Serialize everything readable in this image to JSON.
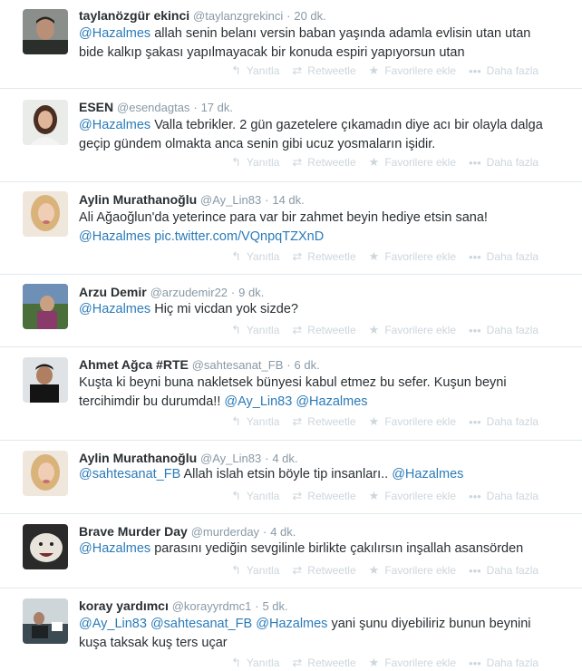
{
  "action_labels": {
    "reply": "Yanıtla",
    "retweet": "Retweetle",
    "favorite": "Favorilere ekle",
    "more": "Daha fazla"
  },
  "tweets": [
    {
      "fullname": "taylanözgür ekinci",
      "handle": "@taylanzgrekinci",
      "dot": "·",
      "time": "20 dk.",
      "mentions_before": "@Hazalmes",
      "text_line1": " allah senin belanı versin baban yaşında adamla evlisin utan utan",
      "text_line2": "bide kalkıp şakası yapılmayacak bir konuda espiri yapıyorsun utan"
    },
    {
      "fullname": "ESEN",
      "handle": "@esendagtas",
      "dot": "·",
      "time": "17 dk.",
      "mentions_before": "@Hazalmes",
      "text_line1": " Valla tebrikler. 2 gün gazetelere çıkamadın diye acı bir olayla dalga",
      "text_line2": "geçip gündem olmakta anca senin gibi ucuz yosmaların işidir."
    },
    {
      "fullname": "Aylin Murathanoğlu",
      "handle": "@Ay_Lin83",
      "dot": "·",
      "time": "14 dk.",
      "text_line1": "Ali Ağaoğlun'da yeterince para var bir zahmet beyin hediye etsin sana!",
      "line2_mention": "@Hazalmes",
      "line2_link": " pic.twitter.com/VQnpqTZXnD"
    },
    {
      "fullname": "Arzu Demir",
      "handle": "@arzudemir22",
      "dot": "·",
      "time": "9 dk.",
      "mentions_before": "@Hazalmes",
      "text_line1": " Hiç mi vicdan yok sizde?"
    },
    {
      "fullname": "Ahmet Ağca #RTE",
      "handle": "@sahtesanat_FB",
      "dot": "·",
      "time": "6 dk.",
      "text_line1": "Kuşta ki beyni buna nakletsek bünyesi kabul etmez bu sefer. Kuşun beyni",
      "text_line2": "tercihimdir bu durumda!! ",
      "mention_a": "@Ay_Lin83",
      "mention_b": " @Hazalmes"
    },
    {
      "fullname": "Aylin Murathanoğlu",
      "handle": "@Ay_Lin83",
      "dot": "·",
      "time": "4 dk.",
      "mentions_before": "@sahtesanat_FB",
      "text_line1": " Allah islah etsin böyle tip insanları.. ",
      "mention_after": "@Hazalmes"
    },
    {
      "fullname": "Brave Murder Day",
      "handle": "@murderday",
      "dot": "·",
      "time": "4 dk.",
      "mentions_before": "@Hazalmes",
      "text_line1": " parasını yediğin sevgilinle birlikte çakılırsın inşallah asansörden"
    },
    {
      "fullname": "koray yardımcı",
      "handle": "@korayyrdmc1",
      "dot": "·",
      "time": "5 dk.",
      "mention_a": "@Ay_Lin83",
      "mention_b": " @sahtesanat_FB",
      "mention_c": " @Hazalmes",
      "text_line1": " yani şunu diyebiliriz bunun beynini",
      "text_line2": "kuşa taksak kuş ters uçar"
    }
  ]
}
